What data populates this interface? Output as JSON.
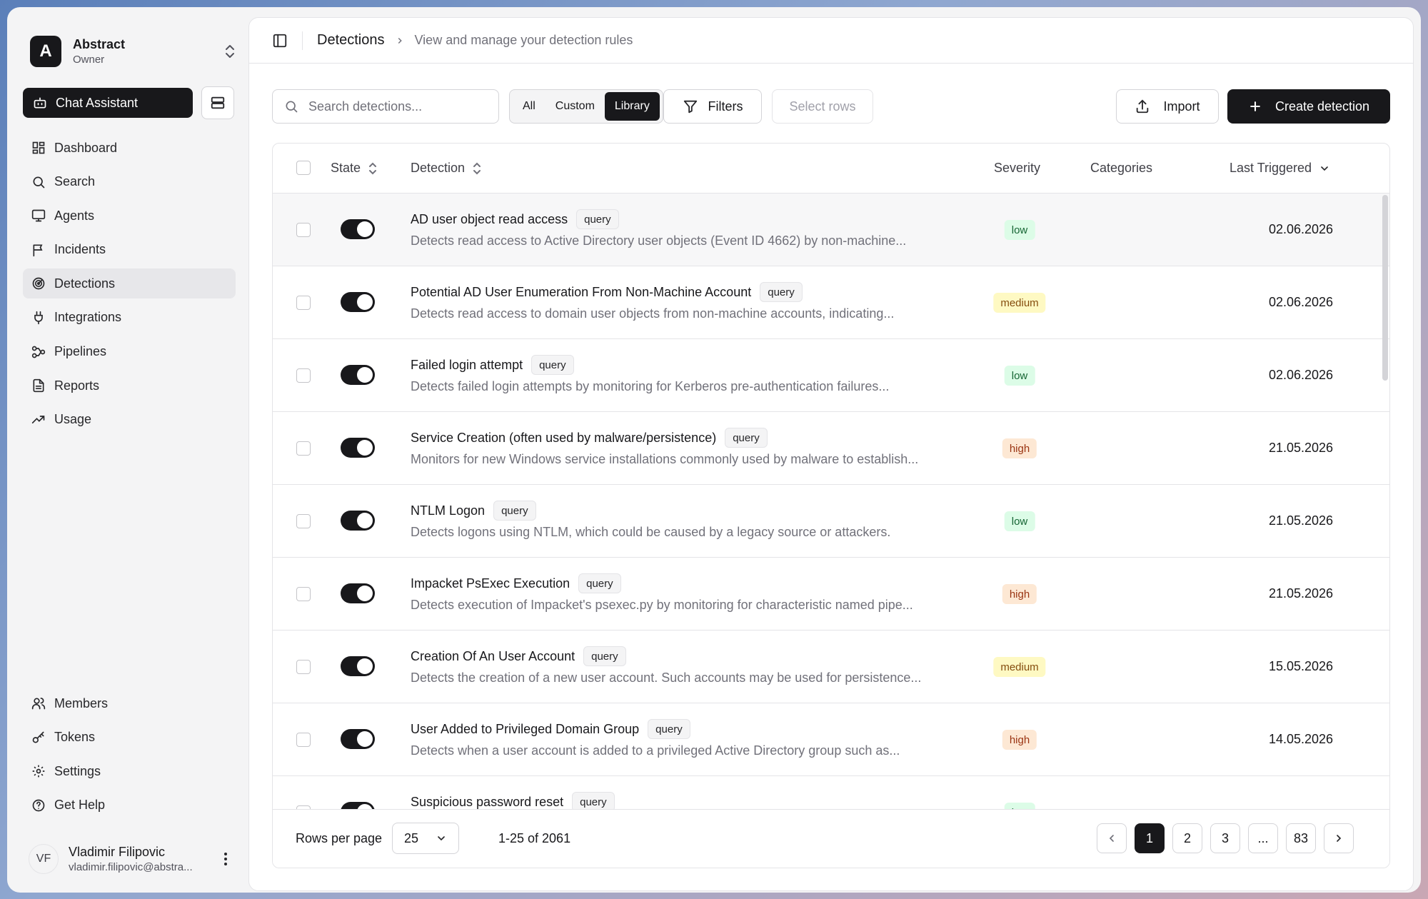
{
  "org": {
    "initial": "A",
    "name": "Abstract",
    "role": "Owner"
  },
  "sidebar": {
    "chat_label": "Chat Assistant",
    "items": [
      {
        "label": "Dashboard",
        "icon": "dashboard-icon"
      },
      {
        "label": "Search",
        "icon": "search-icon"
      },
      {
        "label": "Agents",
        "icon": "monitor-icon"
      },
      {
        "label": "Incidents",
        "icon": "flag-icon"
      },
      {
        "label": "Detections",
        "icon": "radar-icon"
      },
      {
        "label": "Integrations",
        "icon": "plug-icon"
      },
      {
        "label": "Pipelines",
        "icon": "workflow-icon"
      },
      {
        "label": "Reports",
        "icon": "file-text-icon"
      },
      {
        "label": "Usage",
        "icon": "trending-up-icon"
      }
    ],
    "bottom_items": [
      {
        "label": "Members",
        "icon": "users-icon"
      },
      {
        "label": "Tokens",
        "icon": "key-icon"
      },
      {
        "label": "Settings",
        "icon": "gear-icon"
      },
      {
        "label": "Get Help",
        "icon": "help-circle-icon"
      }
    ],
    "user": {
      "initials": "VF",
      "name": "Vladimir Filipovic",
      "email": "vladimir.filipovic@abstra..."
    }
  },
  "header": {
    "title": "Detections",
    "description": "View and manage your detection rules"
  },
  "toolbar": {
    "search_placeholder": "Search detections...",
    "tabs": [
      "All",
      "Custom",
      "Library"
    ],
    "active_tab": "Library",
    "filters_label": "Filters",
    "select_rows_label": "Select rows",
    "import_label": "Import",
    "create_label": "Create detection"
  },
  "table": {
    "columns": {
      "state": "State",
      "detection": "Detection",
      "severity": "Severity",
      "categories": "Categories",
      "last_triggered": "Last Triggered"
    },
    "rows": [
      {
        "title": "AD user object read access",
        "tag": "query",
        "desc": "Detects read access to Active Directory user objects (Event ID 4662) by non-machine...",
        "severity": "low",
        "date": "02.06.2026"
      },
      {
        "title": "Potential AD User Enumeration From Non-Machine Account",
        "tag": "query",
        "desc": "Detects read access to domain user objects from non-machine accounts, indicating...",
        "severity": "medium",
        "date": "02.06.2026"
      },
      {
        "title": "Failed login attempt",
        "tag": "query",
        "desc": "Detects failed login attempts by monitoring for Kerberos pre-authentication failures...",
        "severity": "low",
        "date": "02.06.2026"
      },
      {
        "title": "Service Creation (often used by malware/persistence)",
        "tag": "query",
        "desc": "Monitors for new Windows service installations commonly used by malware to establish...",
        "severity": "high",
        "date": "21.05.2026"
      },
      {
        "title": "NTLM Logon",
        "tag": "query",
        "desc": "Detects logons using NTLM, which could be caused by a legacy source or attackers.",
        "severity": "low",
        "date": "21.05.2026"
      },
      {
        "title": "Impacket PsExec Execution",
        "tag": "query",
        "desc": "Detects execution of Impacket's psexec.py by monitoring for characteristic named pipe...",
        "severity": "high",
        "date": "21.05.2026"
      },
      {
        "title": "Creation Of An User Account",
        "tag": "query",
        "desc": "Detects the creation of a new user account. Such accounts may be used for persistence...",
        "severity": "medium",
        "date": "15.05.2026"
      },
      {
        "title": "User Added to Privileged Domain Group",
        "tag": "query",
        "desc": "Detects when a user account is added to a privileged Active Directory group such as...",
        "severity": "high",
        "date": "14.05.2026"
      },
      {
        "title": "Suspicious password reset",
        "tag": "query",
        "desc": "",
        "severity": "low",
        "date": ""
      }
    ]
  },
  "footer": {
    "rows_per_page_label": "Rows per page",
    "rows_per_page": "25",
    "range": "1-25 of 2061",
    "pages": [
      "1",
      "2",
      "3",
      "...",
      "83"
    ],
    "current_page": "1"
  }
}
